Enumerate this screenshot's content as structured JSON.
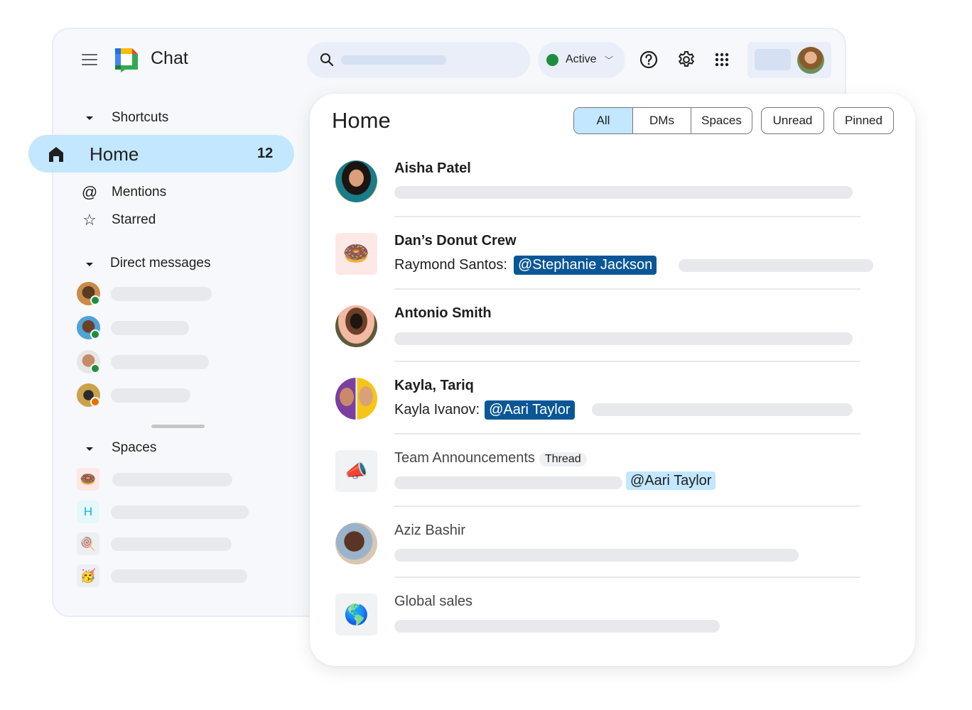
{
  "app": {
    "title": "Chat",
    "status_label": "Active",
    "colors": {
      "accent": "#c2e7ff",
      "status_active": "#1e8e3e",
      "status_away": "#e37400",
      "mention_dark": "#0b5796"
    }
  },
  "header": {
    "icons": [
      "menu-icon",
      "search-icon",
      "help-icon",
      "settings-icon",
      "apps-icon"
    ]
  },
  "sidebar": {
    "shortcuts_label": "Shortcuts",
    "home": {
      "label": "Home",
      "count": "12"
    },
    "items": [
      {
        "label": "Mentions",
        "icon": "@"
      },
      {
        "label": "Starred",
        "icon": "☆"
      }
    ],
    "direct_messages_label": "Direct messages",
    "dms": [
      {
        "status": "active"
      },
      {
        "status": "active"
      },
      {
        "status": "active"
      },
      {
        "status": "away"
      }
    ],
    "spaces_label": "Spaces",
    "spaces": [
      {
        "icon": "🍩"
      },
      {
        "icon": "H"
      },
      {
        "icon": "🍭"
      },
      {
        "icon": "🥳"
      }
    ]
  },
  "home": {
    "title": "Home",
    "filters": {
      "segmented": [
        "All",
        "DMs",
        "Spaces"
      ],
      "active": "All",
      "chips": [
        "Unread",
        "Pinned"
      ]
    },
    "conversations": [
      {
        "name": "Aisha Patel",
        "unread": true
      },
      {
        "name": "Dan’s Donut Crew",
        "unread": true,
        "sender": "Raymond Santos:",
        "mention": "@Stephanie Jackson",
        "icon": "🍩"
      },
      {
        "name": "Antonio Smith",
        "unread": true
      },
      {
        "name": "Kayla, Tariq",
        "unread": true,
        "sender": "Kayla Ivanov:",
        "mention": "@Aari Taylor"
      },
      {
        "name": "Team Announcements",
        "unread": false,
        "badge": "Thread",
        "mention": "@Aari Taylor",
        "icon": "📣"
      },
      {
        "name": "Aziz Bashir",
        "unread": false
      },
      {
        "name": "Global sales",
        "unread": false,
        "icon": "🌎"
      }
    ]
  }
}
